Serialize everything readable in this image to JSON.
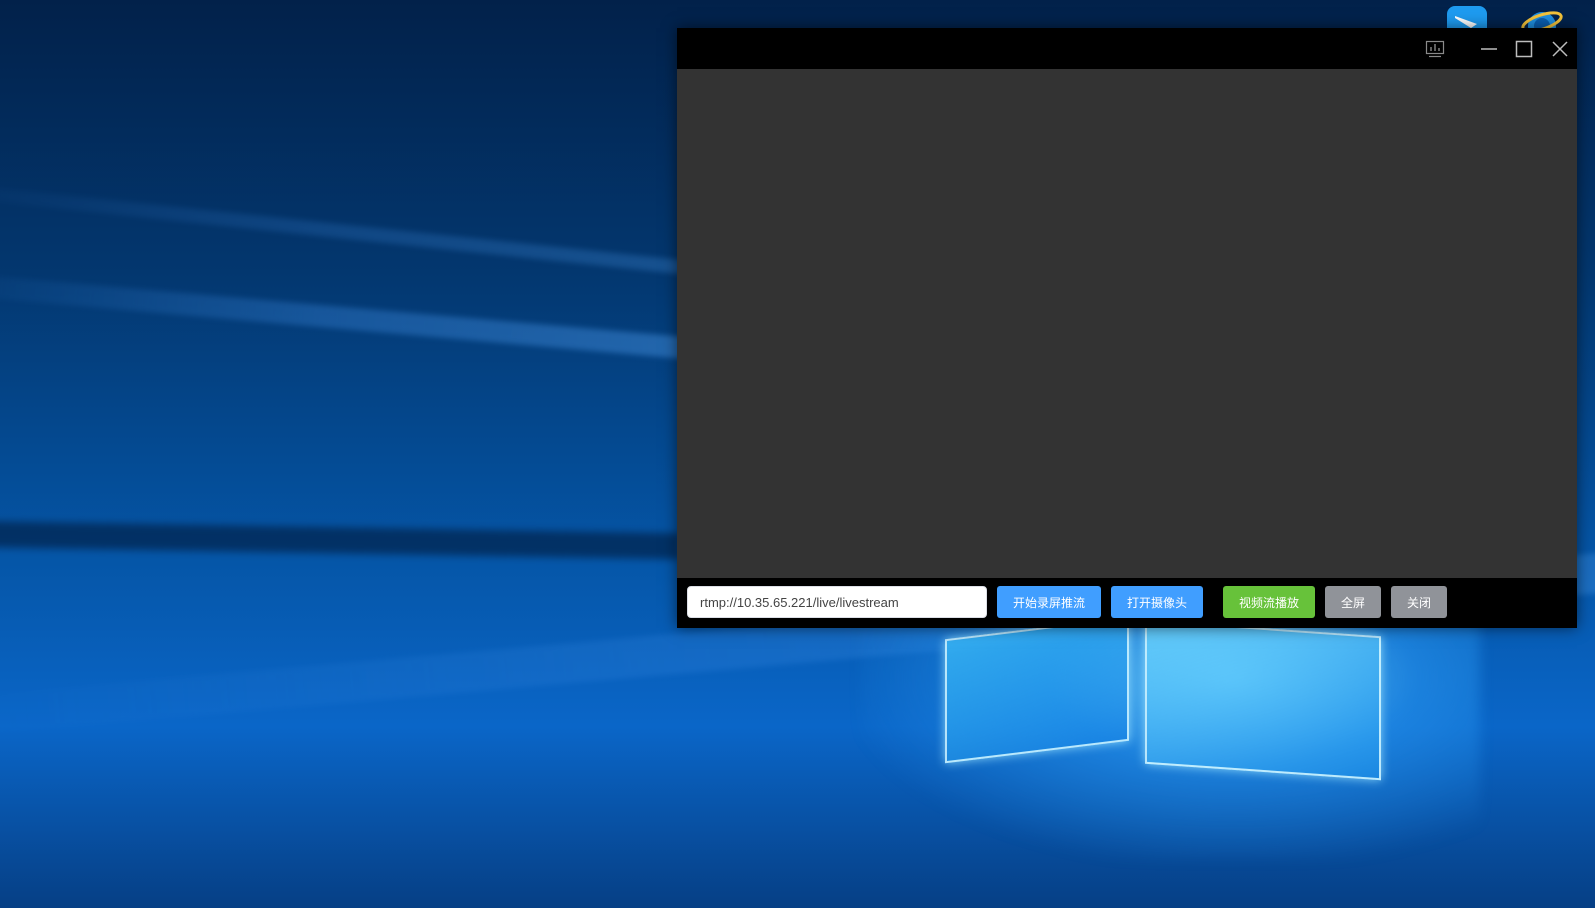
{
  "colors": {
    "window_bg": "#000000",
    "video_bg": "#333333",
    "primary_blue": "#409eff",
    "success_green": "#67c23a",
    "info_gray": "#909399"
  },
  "title_bar": {
    "icons": [
      "stats-icon",
      "minimize-icon",
      "maximize-icon",
      "close-icon"
    ]
  },
  "controls": {
    "stream_url": "rtmp://10.35.65.221/live/livestream",
    "buttons": {
      "screen_push": "开始录屏推流",
      "open_camera": "打开摄像头",
      "play_stream": "视频流播放",
      "fullscreen": "全屏",
      "close": "关闭"
    }
  },
  "desktop_icons": [
    "app-shortcut-icon",
    "internet-explorer-icon"
  ]
}
